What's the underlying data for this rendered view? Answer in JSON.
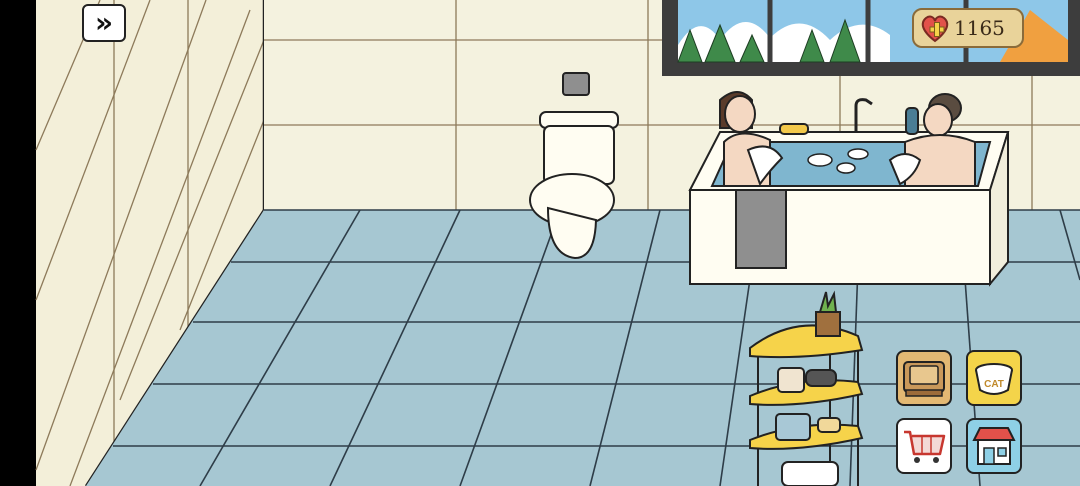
{
  "hud": {
    "forward_icon": "double-chevron-right-icon",
    "heart_count": "1165",
    "heart_icon": "heart-plus-icon"
  },
  "buttons": [
    {
      "name": "storage-box-button",
      "icon": "box-icon",
      "color": "#e3b873"
    },
    {
      "name": "cat-food-button",
      "icon": "cat-bowl-icon",
      "label": "CAT",
      "color": "#f4d44a"
    },
    {
      "name": "shopping-cart-button",
      "icon": "cart-icon",
      "color": "#ffffff"
    },
    {
      "name": "shop-button",
      "icon": "store-icon",
      "color": "#8ed0e6"
    }
  ],
  "colors": {
    "wall": "#f4f1dd",
    "floor": "#a7c8d3",
    "grout": "#2b3a44",
    "accent_yellow": "#f6d34a"
  }
}
